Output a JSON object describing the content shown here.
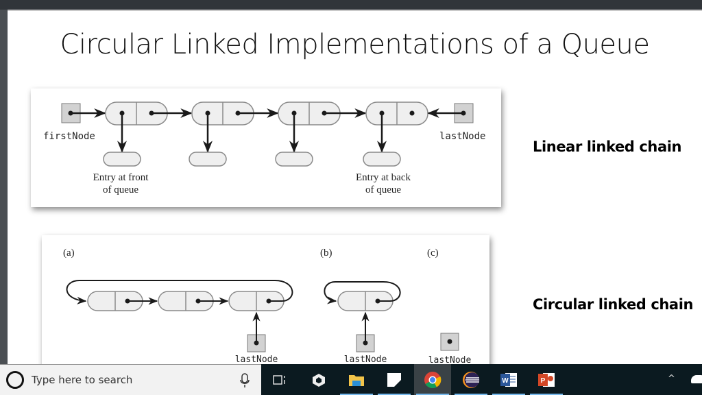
{
  "slide": {
    "title": "Circular Linked Implementations of a Queue",
    "labels": {
      "linear": "Linear linked chain",
      "circular": "Circular linked chain"
    },
    "linear_figure": {
      "first_node_label": "firstNode",
      "last_node_label": "lastNode",
      "front_caption_line1": "Entry at front",
      "front_caption_line2": "of queue",
      "back_caption_line1": "Entry at back",
      "back_caption_line2": "of queue",
      "node_count": 4
    },
    "circular_figure": {
      "parts": [
        {
          "tag": "(a)",
          "node_count": 3,
          "pointer_label": "lastNode"
        },
        {
          "tag": "(b)",
          "node_count": 1,
          "pointer_label": "lastNode"
        },
        {
          "tag": "(c)",
          "node_count": 0,
          "pointer_label": "lastNode"
        }
      ]
    }
  },
  "taskbar": {
    "search_placeholder": "Type here to search",
    "apps": [
      {
        "name": "task-view",
        "active": false,
        "running": false
      },
      {
        "name": "unity",
        "active": false,
        "running": false
      },
      {
        "name": "file-explorer",
        "active": false,
        "running": true
      },
      {
        "name": "sticky-app",
        "active": false,
        "running": true
      },
      {
        "name": "chrome",
        "active": true,
        "running": true
      },
      {
        "name": "eclipse",
        "active": false,
        "running": true
      },
      {
        "name": "word",
        "active": false,
        "running": true
      },
      {
        "name": "powerpoint",
        "active": false,
        "running": true
      }
    ],
    "tray_chevron": "^"
  },
  "colors": {
    "node_fill": "#efefef",
    "node_stroke": "#8a8a8a",
    "pointer_box_fill": "#d2d2d2",
    "arrow": "#1a1a1a",
    "taskbar_bg": "#0b1a20",
    "running_indicator": "#76b9ed"
  }
}
